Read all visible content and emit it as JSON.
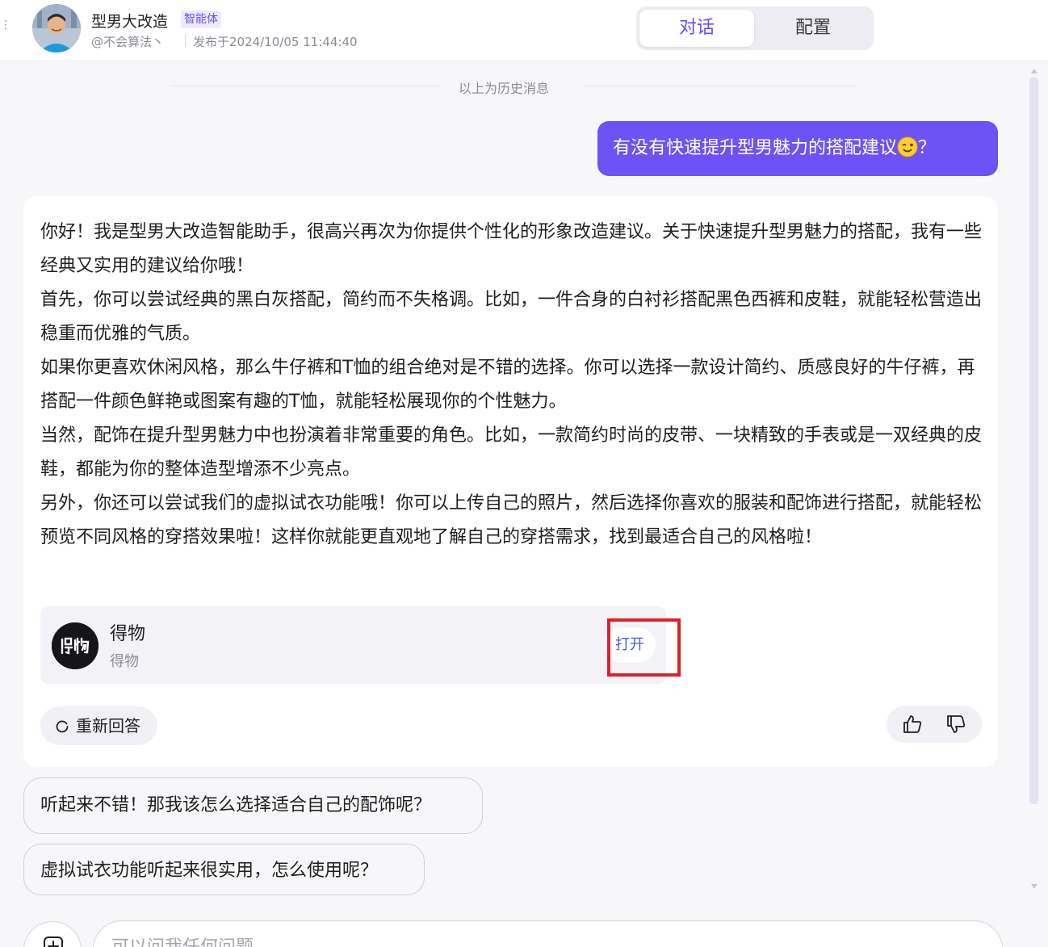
{
  "header": {
    "agent_name": "型男大改造",
    "agent_badge": "智能体",
    "author": "@不会算法丶",
    "published": "发布于2024/10/05 11:44:40",
    "tabs": [
      {
        "label": "对话",
        "active": true
      },
      {
        "label": "配置",
        "active": false
      }
    ]
  },
  "history_divider": "以上为历史消息",
  "user_message": {
    "text_before_emoji": "有没有快速提升型男魅力的搭配建议",
    "emoji_icon": "winking-face-emoji",
    "text_after_emoji": "？"
  },
  "bot_message": {
    "paragraphs": [
      "你好！我是型男大改造智能助手，很高兴再次为你提供个性化的形象改造建议。关于快速提升型男魅力的搭配，我有一些经典又实用的建议给你哦！",
      "首先，你可以尝试经典的黑白灰搭配，简约而不失格调。比如，一件合身的白衬衫搭配黑色西裤和皮鞋，就能轻松营造出稳重而优雅的气质。",
      "如果你更喜欢休闲风格，那么牛仔裤和T恤的组合绝对是不错的选择。你可以选择一款设计简约、质感良好的牛仔裤，再搭配一件颜色鲜艳或图案有趣的T恤，就能轻松展现你的个性魅力。",
      "当然，配饰在提升型男魅力中也扮演着非常重要的角色。比如，一款简约时尚的皮带、一块精致的手表或是一双经典的皮鞋，都能为你的整体造型增添不少亮点。",
      "另外，你还可以尝试我们的虚拟试衣功能哦！你可以上传自己的照片，然后选择你喜欢的服装和配饰进行搭配，就能轻松预览不同风格的穿搭效果啦！这样你就能更直观地了解自己的穿搭需求，找到最适合自己的风格啦！"
    ],
    "app_card": {
      "icon_logo_text": "得物",
      "name": "得物",
      "subtitle": "得物",
      "open_label": "打开"
    },
    "regenerate_label": "重新回答"
  },
  "suggestions": [
    "听起来不错！那我该怎么选择适合自己的配饰呢？",
    "虚拟试衣功能听起来很实用，怎么使用呢？"
  ],
  "input": {
    "placeholder": "可以问我任何问题..."
  },
  "colors": {
    "accent": "#6d52f5",
    "highlight_box": "#e01f2a",
    "link_blue": "#4f5bd5"
  }
}
